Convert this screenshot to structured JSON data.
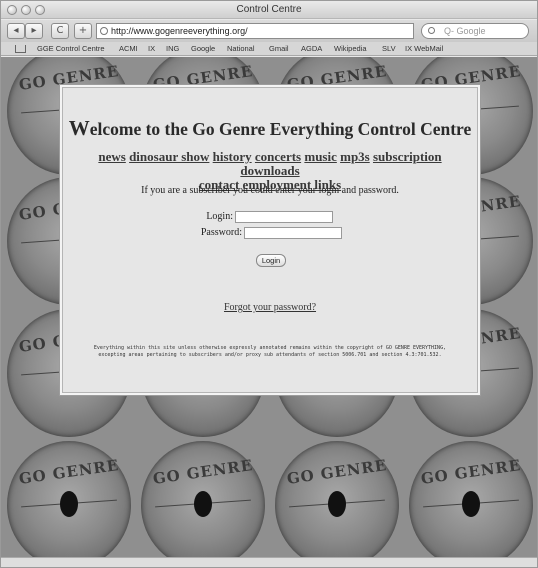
{
  "window": {
    "title": "Control Centre"
  },
  "toolbar": {
    "back_icon": "back-arrow-icon",
    "forward_icon": "forward-arrow-icon",
    "reload_symbol": "C",
    "add_symbol": "+",
    "url": "http://www.gogenreeverything.org/",
    "search_placeholder": "Q- Google"
  },
  "bookmarks": [
    "GGE Control Centre",
    "ACMI",
    "IX",
    "ING",
    "Google",
    "National",
    "Gmail",
    "AGDA",
    "Wikipedia",
    "SLV",
    "IX WebMail"
  ],
  "background": {
    "tile_text": "GO GENRE"
  },
  "panel": {
    "welcome_initial": "W",
    "welcome_rest": "elcome to the Go Genre Everything Control Centre",
    "links": [
      "news",
      "dinosaur show",
      "history",
      "concerts",
      "music",
      "mp3s",
      "subscription",
      "downloads",
      "contact",
      "employment links"
    ],
    "intro": "If you are a subscriber you could enter your login and password.",
    "login_label": "Login:",
    "password_label": "Password:",
    "login_button": "Login",
    "forgot": "Forgot your password?",
    "fineprint": "Everything within this site unless otherwise expressly annotated remains within the copyright of GO GENRE EVERYTHING, excepting areas pertaining to subscribers and/or proxy sub attendants of section 5006.701 and section 4.3:701.532."
  }
}
